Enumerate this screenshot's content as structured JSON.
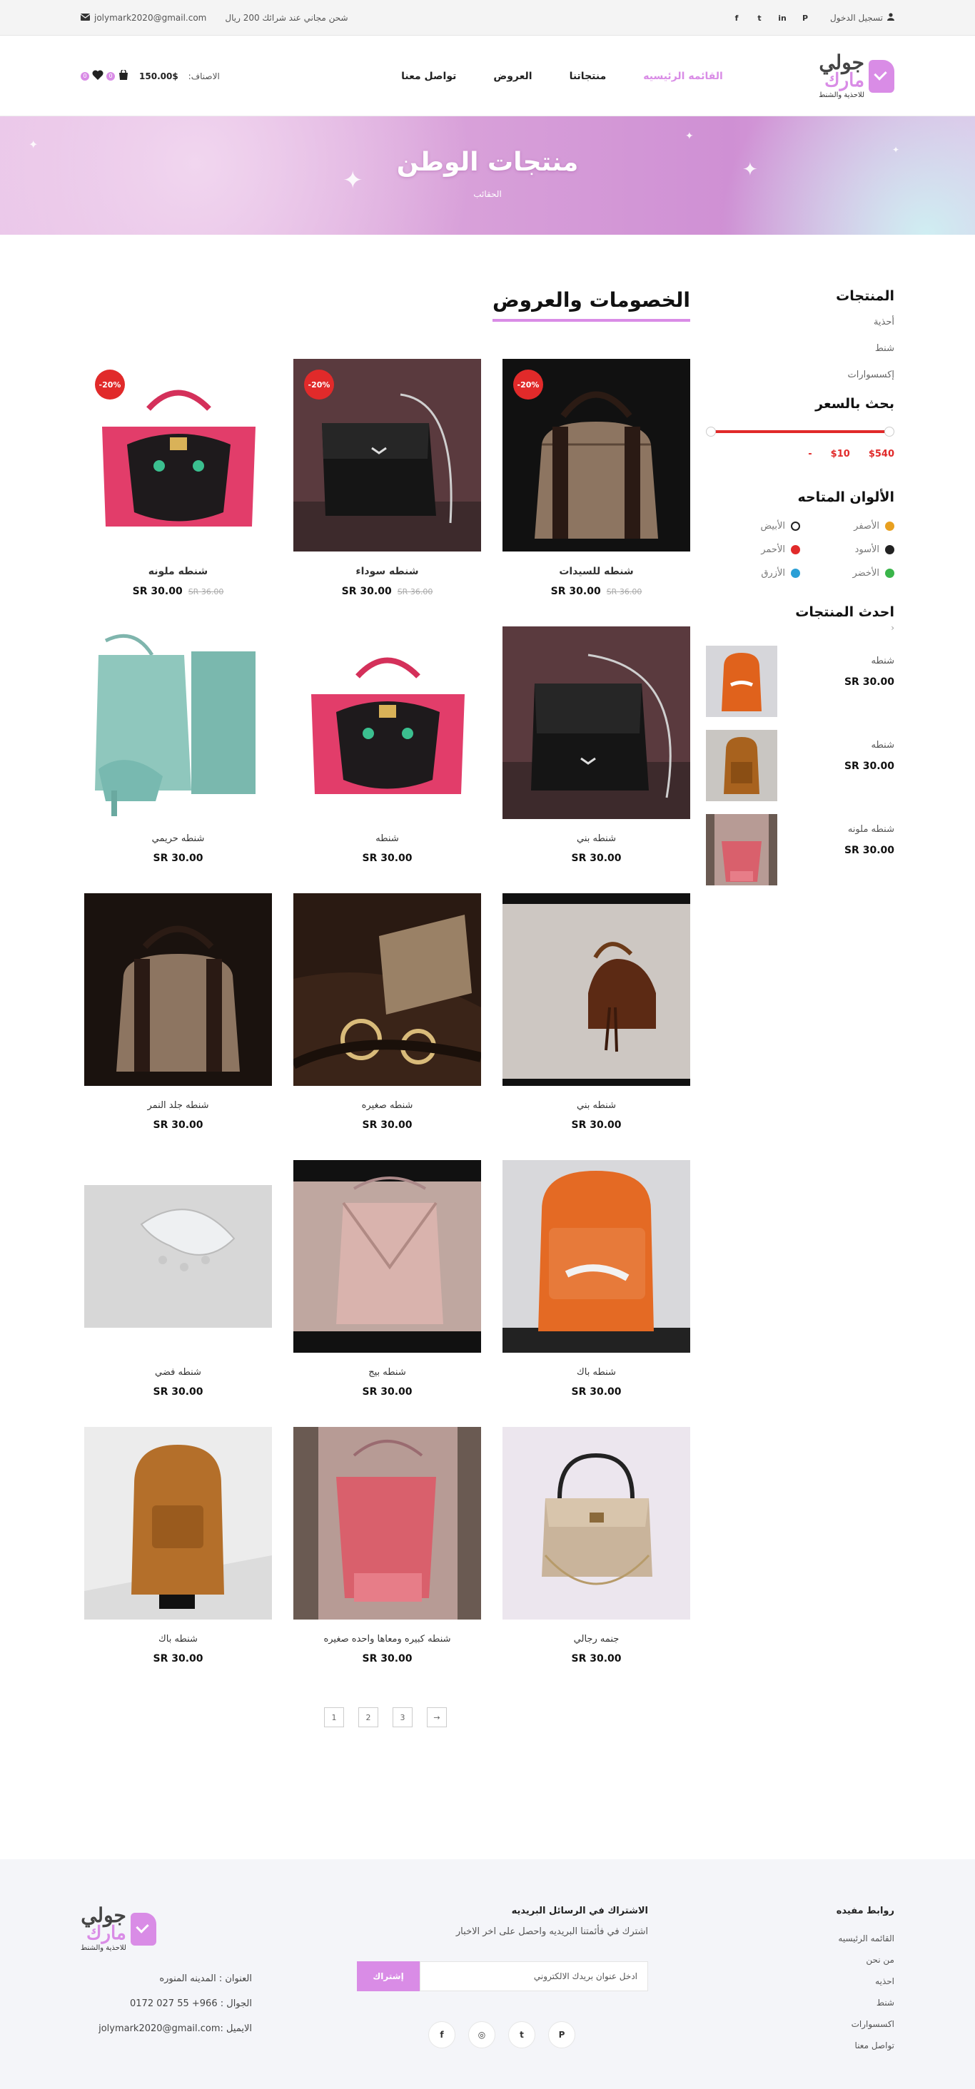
{
  "topbar": {
    "login": "تسجيل الدخول",
    "social": [
      "P",
      "in",
      "t",
      "f"
    ],
    "shipping": "شحن مجاني عند شرائك 200 ريال",
    "email": "jolymark2020@gmail.com"
  },
  "logo": {
    "line1": "جولي",
    "line2": "مارك",
    "line3": "للاحذية والشنط"
  },
  "nav": {
    "items": [
      "القائمه الرئيسيه",
      "منتجاتنا",
      "العروض",
      "تواصل معنا"
    ]
  },
  "cart": {
    "label": "الاصناف:",
    "total": "150.00$",
    "wish_count": "0",
    "cart_count": "0"
  },
  "hero": {
    "title": "منتجات الوطن",
    "breadcrumb": "الحقائب"
  },
  "sidebar": {
    "categories_title": "المنتجات",
    "categories": [
      "أحذية",
      "شنط",
      "إكسسوارات"
    ],
    "price_title": "بحث بالسعر",
    "price_min": "$10",
    "price_max": "$540",
    "price_dash": "-",
    "colors_title": "الألوان المتاحه",
    "colors": [
      {
        "label": "الأصفر",
        "color": "#e8a020"
      },
      {
        "label": "الأبيض",
        "color": "#ffffff"
      },
      {
        "label": "الأسود",
        "color": "#222222"
      },
      {
        "label": "الأحمر",
        "color": "#e12a2a"
      },
      {
        "label": "الأخضر",
        "color": "#3ab54a"
      },
      {
        "label": "الأزرق",
        "color": "#2a9fd6"
      }
    ],
    "latest_title": "احدث المنتجات",
    "latest": [
      {
        "name": "شنطه",
        "price": "SR 30.00"
      },
      {
        "name": "شنطه",
        "price": "SR 30.00"
      },
      {
        "name": "شنطه ملونه",
        "price": "SR 30.00"
      }
    ]
  },
  "main": {
    "title": "الخصومات والعروض",
    "products": [
      {
        "name": "شنطه للسيدات",
        "price": "SR 30.00",
        "old": "SR 36.00",
        "sale": "-20%"
      },
      {
        "name": "شنطه سوداء",
        "price": "SR 30.00",
        "old": "SR 36.00",
        "sale": "-20%"
      },
      {
        "name": "شنطه ملونه",
        "price": "SR 30.00",
        "old": "SR 36.00",
        "sale": "-20%"
      },
      {
        "name": "شنطه بني",
        "price": "SR 30.00"
      },
      {
        "name": "شنطه",
        "price": "SR 30.00"
      },
      {
        "name": "شنطه حريمي",
        "price": "SR 30.00"
      },
      {
        "name": "شنطه بني",
        "price": "SR 30.00"
      },
      {
        "name": "شنطه صغيره",
        "price": "SR 30.00"
      },
      {
        "name": "شنطه جلد النمر",
        "price": "SR 30.00"
      },
      {
        "name": "شنطه باك",
        "price": "SR 30.00"
      },
      {
        "name": "شنطه بيج",
        "price": "SR 30.00"
      },
      {
        "name": "شنطه فضي",
        "price": "SR 30.00"
      },
      {
        "name": "جنمه رجالي",
        "price": "SR 30.00"
      },
      {
        "name": "شنطه كبيره ومعاها واحده صغيره",
        "price": "SR 30.00"
      },
      {
        "name": "شنطه باك",
        "price": "SR 30.00"
      }
    ],
    "pagination": [
      "1",
      "2",
      "3",
      "→"
    ]
  },
  "footer": {
    "links_title": "روابط مفيده",
    "links": [
      "القائمه الرئيسيه",
      "من نحن",
      "احذيه",
      "شنط",
      "اكسسوارات",
      "تواصل معنا"
    ],
    "news_title": "الاشتراك في الرسائل البريديه",
    "news_text": "اشترك في فأئمتنا البريديه واحصل على اخر الاخبار",
    "news_placeholder": "ادخل عنوان بريدك الالكتروني",
    "news_button": "إشتراك",
    "social": [
      "P",
      "t",
      "◎",
      "f"
    ],
    "address": "العنوان : المدينه المنوره",
    "phone": "الجوال : 966+ 55 027 0172",
    "email": "الايميل :jolymark2020@gmail.com"
  }
}
